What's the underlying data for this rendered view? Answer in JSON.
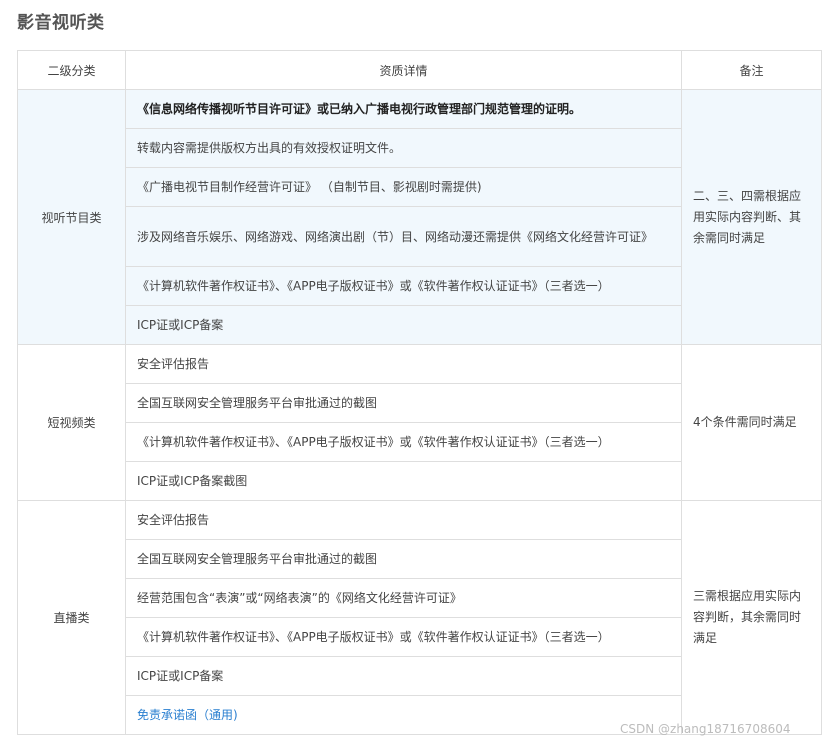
{
  "title": "影音视听类",
  "headers": [
    "二级分类",
    "资质详情",
    "备注"
  ],
  "groups": [
    {
      "category": "视听节目类",
      "note": "二、三、四需根据应用实际内容判断、其余需同时满足",
      "items": [
        "《信息网络传播视听节目许可证》或已纳入广播电视行政管理部门规范管理的证明。",
        "转载内容需提供版权方出具的有效授权证明文件。",
        "《广播电视节目制作经营许可证》 （自制节目、影视剧时需提供)",
        "涉及网络音乐娱乐、网络游戏、网络演出剧（节）目、网络动漫还需提供《网络文化经营许可证》",
        "《计算机软件著作权证书》、《APP电子版权证书》或《软件著作权认证证书》（三者选一）",
        "ICP证或ICP备案"
      ]
    },
    {
      "category": "短视频类",
      "note": "4个条件需同时满足",
      "items": [
        "安全评估报告",
        "全国互联网安全管理服务平台审批通过的截图",
        "《计算机软件著作权证书》、《APP电子版权证书》或《软件著作权认证证书》（三者选一）",
        "ICP证或ICP备案截图"
      ]
    },
    {
      "category": "直播类",
      "note": "三需根据应用实际内容判断，其余需同时满足",
      "items": [
        "安全评估报告",
        "全国互联网安全管理服务平台审批通过的截图",
        "经营范围包含“表演”或“网络表演”的《网络文化经营许可证》",
        "《计算机软件著作权证书》、《APP电子版权证书》或《软件著作权认证证书》（三者选一）",
        "ICP证或ICP备案",
        "免责承诺函（通用)"
      ]
    }
  ],
  "watermark": "CSDN @zhang18716708604",
  "colors": {
    "highlight_bg": "#f1f8fd",
    "border": "#dedede",
    "link": "#2a7fd0"
  }
}
